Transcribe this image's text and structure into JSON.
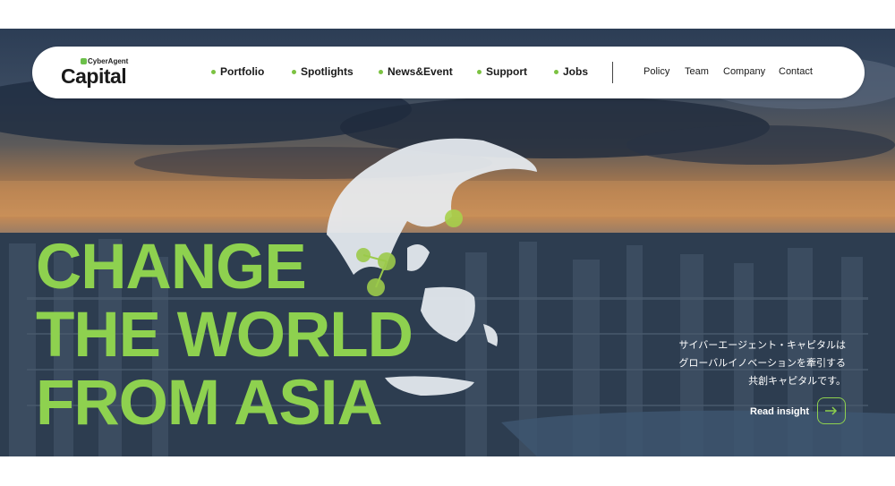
{
  "brand": {
    "small": "CyberAgent",
    "name": "Capital"
  },
  "nav": {
    "main": [
      "Portfolio",
      "Spotlights",
      "News&Event",
      "Support",
      "Jobs"
    ],
    "sub": [
      "Policy",
      "Team",
      "Company",
      "Contact"
    ]
  },
  "hero": {
    "headline": [
      "CHANGE",
      "THE WORLD",
      "FROM ASIA"
    ],
    "description": [
      "サイバーエージェント・キャピタルは",
      "グローバルイノベーションを牽引する",
      "共創キャピタルです。"
    ],
    "cta": "Read insight"
  },
  "colors": {
    "accent": "#8ed14f",
    "nav_bg": "#ffffff",
    "text_dark": "#1a1a1a"
  },
  "icons": {
    "cta": "arrow-right-icon",
    "logo": "cyberagent-leaf-icon"
  }
}
